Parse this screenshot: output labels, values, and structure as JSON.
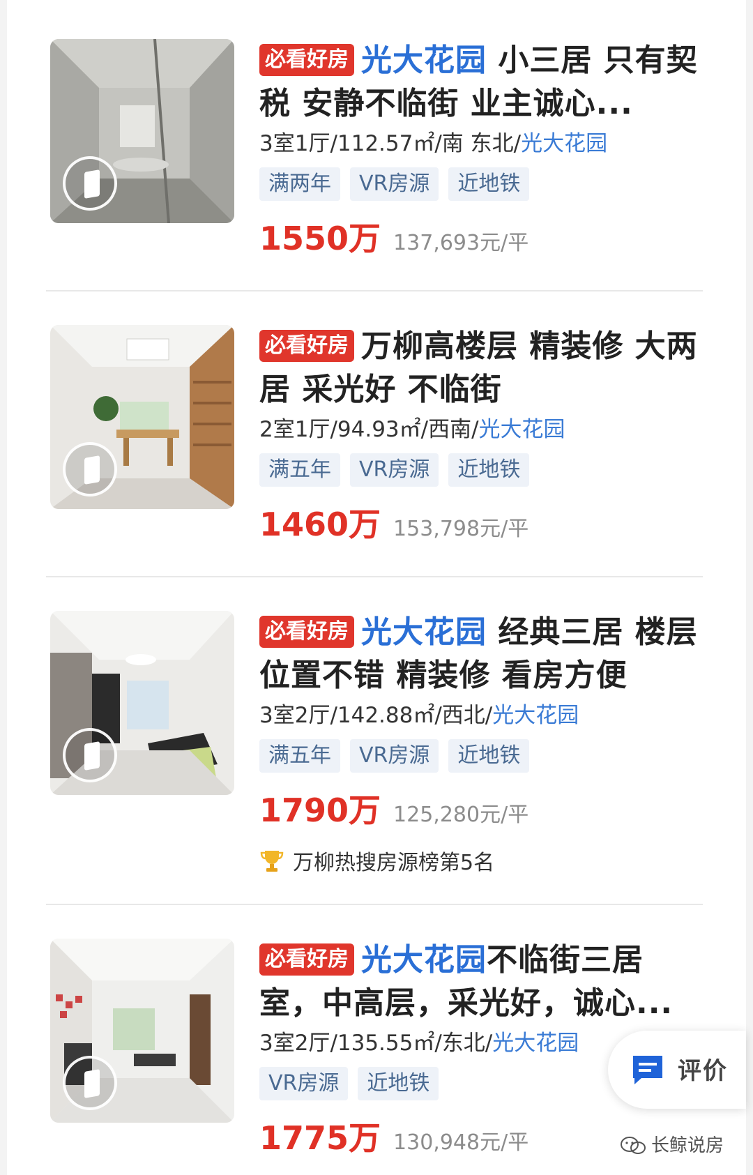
{
  "listings": [
    {
      "badge": "必看好房",
      "community": "光大花园",
      "title_rest": " 小三居 只有契税 安静不临街 业主诚心...",
      "meta_prefix": "3室1厅/112.57㎡/南 东北/",
      "meta_community": "光大花园",
      "tags": [
        "满两年",
        "VR房源",
        "近地铁"
      ],
      "price": "1550万",
      "unit_price": "137,693元/平",
      "rank": ""
    },
    {
      "badge": "必看好房",
      "community": "",
      "title_rest": "万柳高楼层 精装修 大两居 采光好 不临街",
      "meta_prefix": "2室1厅/94.93㎡/西南/",
      "meta_community": "光大花园",
      "tags": [
        "满五年",
        "VR房源",
        "近地铁"
      ],
      "price": "1460万",
      "unit_price": "153,798元/平",
      "rank": ""
    },
    {
      "badge": "必看好房",
      "community": "光大花园",
      "title_rest": " 经典三居 楼层位置不错 精装修 看房方便",
      "meta_prefix": "3室2厅/142.88㎡/西北/",
      "meta_community": "光大花园",
      "tags": [
        "满五年",
        "VR房源",
        "近地铁"
      ],
      "price": "1790万",
      "unit_price": "125,280元/平",
      "rank": "万柳热搜房源榜第5名"
    },
    {
      "badge": "必看好房",
      "community": "光大花园",
      "title_rest": "不临街三居室，中高层，采光好，诚心...",
      "meta_prefix": "3室2厅/135.55㎡/东北/",
      "meta_community": "光大花园",
      "tags": [
        "VR房源",
        "近地铁"
      ],
      "price": "1775万",
      "unit_price": "130,948元/平",
      "rank": ""
    }
  ],
  "float_button": {
    "label": "评价",
    "icon": "comment-icon"
  },
  "watermark": {
    "text": "长鲸说房",
    "icon": "wechat-icon"
  },
  "colors": {
    "badge_red": "#e0362c",
    "price_red": "#e03126",
    "community_blue": "#2a6fd6",
    "tag_bg": "#eef2f8",
    "tag_text": "#4a6a92"
  }
}
